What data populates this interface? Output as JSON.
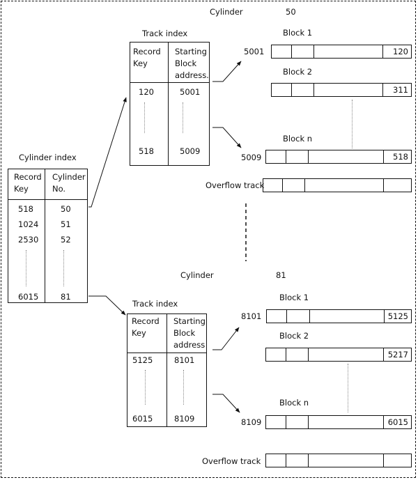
{
  "cylinder_index": {
    "title": "Cylinder index",
    "headers": [
      "Record\nKey",
      "Cylinder\nNo."
    ],
    "header_record_key": [
      "Record",
      "Key"
    ],
    "header_cylinder_no": [
      "Cylinder",
      "No."
    ],
    "rows": [
      {
        "key": "518",
        "cyl": "50"
      },
      {
        "key": "1024",
        "cyl": "51"
      },
      {
        "key": "2530",
        "cyl": "52"
      },
      {
        "key": "6015",
        "cyl": "81"
      }
    ]
  },
  "cylinders": [
    {
      "label": "Cylinder",
      "number": "50",
      "track_index": {
        "title": "Track index",
        "header_record_key": [
          "Record",
          "Key"
        ],
        "header_block_address": [
          "Starting",
          "Block",
          "address."
        ],
        "rows": [
          {
            "key": "120",
            "addr": "5001"
          },
          {
            "key": "518",
            "addr": "5009"
          }
        ]
      },
      "blocks": [
        {
          "title": "Block 1",
          "address": "5001",
          "value": "120"
        },
        {
          "title": "Block 2",
          "address": "",
          "value": "311"
        },
        {
          "title": "Block n",
          "address": "5009",
          "value": "518"
        }
      ],
      "overflow_label": "Overflow track"
    },
    {
      "label": "Cylinder",
      "number": "81",
      "track_index": {
        "title": "Track index",
        "header_record_key": [
          "Record",
          "Key"
        ],
        "header_block_address": [
          "Starting",
          "Block",
          "address"
        ],
        "rows": [
          {
            "key": "5125",
            "addr": "8101"
          },
          {
            "key": "6015",
            "addr": "8109"
          }
        ]
      },
      "blocks": [
        {
          "title": "Block 1",
          "address": "8101",
          "value": "5125"
        },
        {
          "title": "Block 2",
          "address": "",
          "value": "5217"
        },
        {
          "title": "Block n",
          "address": "8109",
          "value": "6015"
        }
      ],
      "overflow_label": "Overflow track"
    }
  ]
}
